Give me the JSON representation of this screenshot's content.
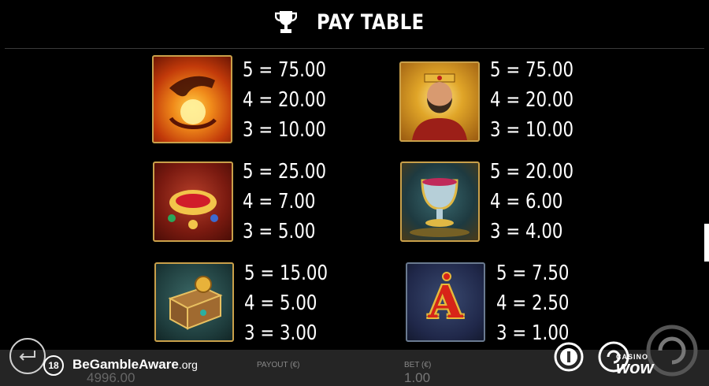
{
  "header": {
    "title": "PAY TABLE",
    "icon": "trophy-icon"
  },
  "symbols": [
    {
      "name": "fire-hand-symbol",
      "pays": [
        "5 = 75.00",
        "4 = 20.00",
        "3 = 10.00"
      ]
    },
    {
      "name": "king-symbol",
      "pays": [
        "5 = 75.00",
        "4 = 20.00",
        "3 = 10.00"
      ]
    },
    {
      "name": "ruby-crown-symbol",
      "pays": [
        "5 = 25.00",
        "4 = 7.00",
        "3 = 5.00"
      ]
    },
    {
      "name": "chalice-symbol",
      "pays": [
        "5 = 20.00",
        "4 = 6.00",
        "3 = 4.00"
      ]
    },
    {
      "name": "treasure-chest-symbol",
      "pays": [
        "5 = 15.00",
        "4 = 5.00",
        "3 = 3.00"
      ]
    },
    {
      "name": "letter-a-symbol",
      "letter": "A",
      "pays": [
        "5 = 7.50",
        "4 = 2.50",
        "3 = 1.00"
      ]
    }
  ],
  "footer": {
    "age_badge": "18",
    "gamble_aware": "BeGambleAware",
    "gamble_aware_suffix": ".org",
    "balance_value": "4996.00",
    "payout_label": "PAYOUT (€)",
    "bet_label": "BET (€)",
    "bet_value": "1.00",
    "brand_top": "CASINO",
    "brand_main": "wow"
  }
}
